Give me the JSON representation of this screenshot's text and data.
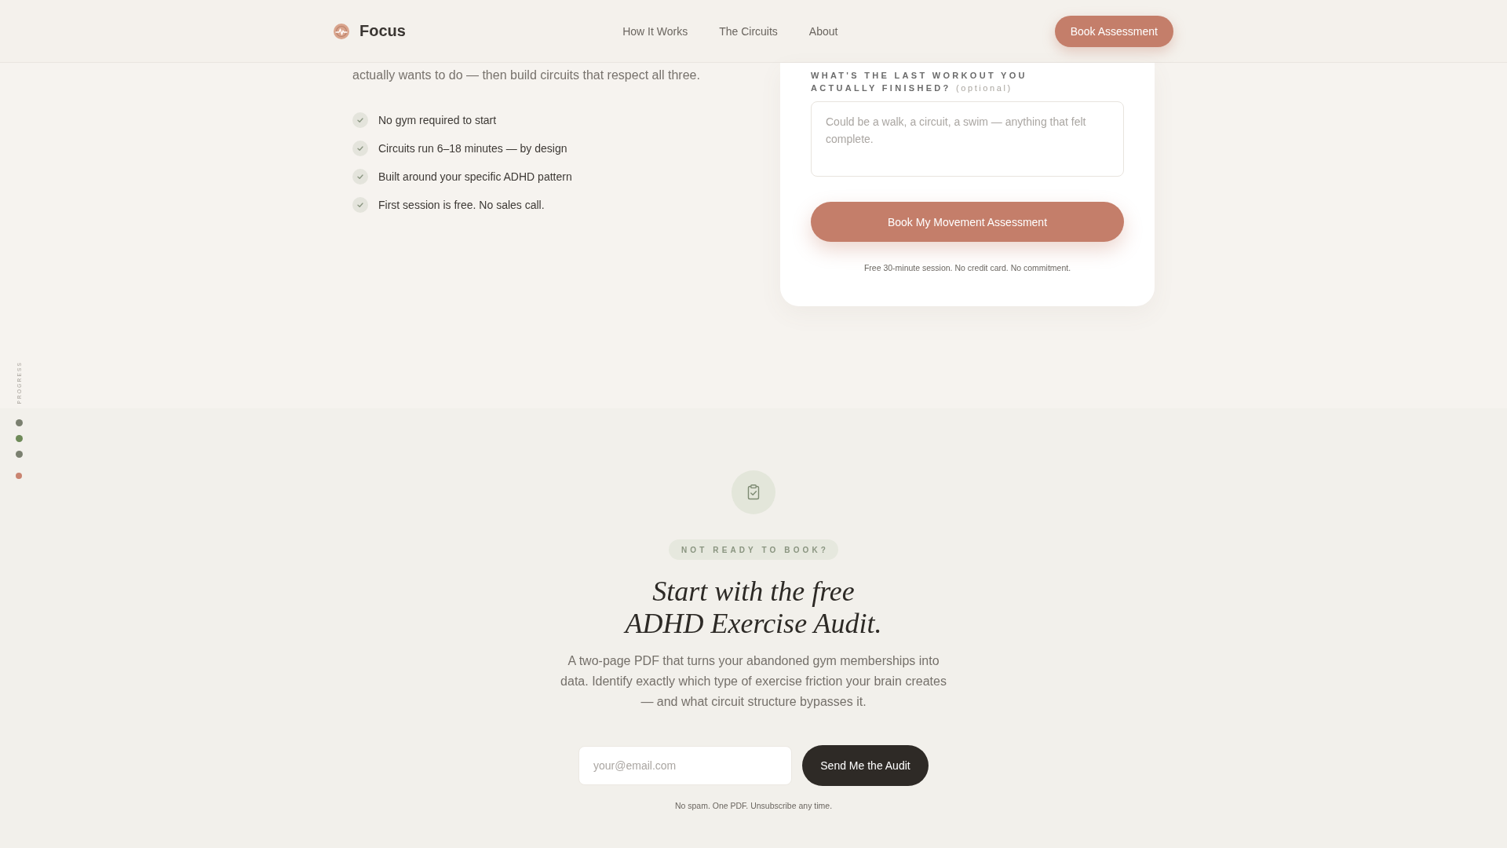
{
  "header": {
    "brand": "Focus",
    "nav": [
      {
        "label": "How It Works"
      },
      {
        "label": "The Circuits"
      },
      {
        "label": "About"
      }
    ],
    "cta": "Book Assessment"
  },
  "intro": {
    "text": "actually wants to do — then build circuits that respect all three.",
    "benefits": [
      "No gym required to start",
      "Circuits run 6–18 minutes — by design",
      "Built around your specific ADHD pattern",
      "First session is free. No sales call."
    ]
  },
  "form_card": {
    "field": {
      "label": "WHAT'S THE LAST WORKOUT YOU ACTUALLY FINISHED?",
      "optional": "(optional)",
      "placeholder": "Could be a walk, a circuit, a swim — anything that felt complete."
    },
    "submit": "Book My Movement Assessment",
    "note": "Free 30-minute session. No credit card. No commitment."
  },
  "progress": {
    "label": "PROGRESS",
    "dots": [
      {
        "color": "#7b8070"
      },
      {
        "color": "#6e8a58"
      },
      {
        "color": "#7b8070"
      },
      {
        "color": "#c98470"
      }
    ]
  },
  "audit": {
    "badge": "NOT READY TO BOOK?",
    "title_lines": [
      "Start with the free",
      "ADHD Exercise Audit."
    ],
    "description": "A two-page PDF that turns your abandoned gym memberships into data. Identify exactly which type of exercise friction your brain creates — and what circuit structure bypasses it.",
    "email": {
      "placeholder": "your@email.com"
    },
    "button": "Send Me the Audit",
    "note": "No spam. One PDF. Unsubscribe any time."
  }
}
